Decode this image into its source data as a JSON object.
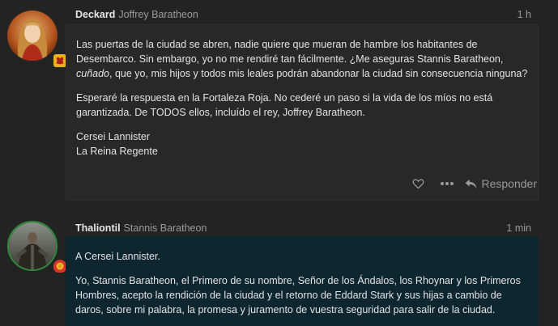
{
  "posts": [
    {
      "username": "Deckard",
      "fullname": "Joffrey Baratheon",
      "time": "1 h",
      "paragraphs": {
        "p1_before": "Las puertas de la ciudad se abren, nadie quiere que mueran de hambre los habitantes de Desembarco. Sin embargo, yo no me rendiré tan fácilmente. ¿Me aseguras Stannis Baratheon, ",
        "p1_em": "cuñado",
        "p1_after": ", que yo, mis hijos y todos mis leales podrán abandonar la ciudad sin consecuencia ninguna?",
        "p2": "Esperaré la respuesta en la Fortaleza Roja. No cederé un paso si la vida de los míos no está garantizada. De TODOS ellos, incluído el rey, Joffrey Baratheon.",
        "sig1": "Cersei Lannister",
        "sig2": "La Reina Regente"
      },
      "actions": {
        "like_icon": "heart-icon",
        "more_icon": "ellipsis-icon",
        "reply_icon": "reply-arrow-icon",
        "reply_label": "Responder"
      },
      "flair_color": "#e8b21a"
    },
    {
      "username": "Thaliontil",
      "fullname": "Stannis Baratheon",
      "time": "1 min",
      "paragraphs": {
        "p1": "A Cersei Lannister.",
        "p2": "Yo, Stannis Baratheon, el Primero de su nombre, Señor de los Ándalos, los Rhoynar y los Primeros Hombres, acepto la rendición de la ciudad y el retorno de Eddard Stark y sus hijas a cambio de daros, sobre mi palabra, la promesa y juramento de vuestra seguridad para salir de la ciudad."
      },
      "flair_color": "#d6372a",
      "highlight_color": "#0e2630"
    }
  ]
}
